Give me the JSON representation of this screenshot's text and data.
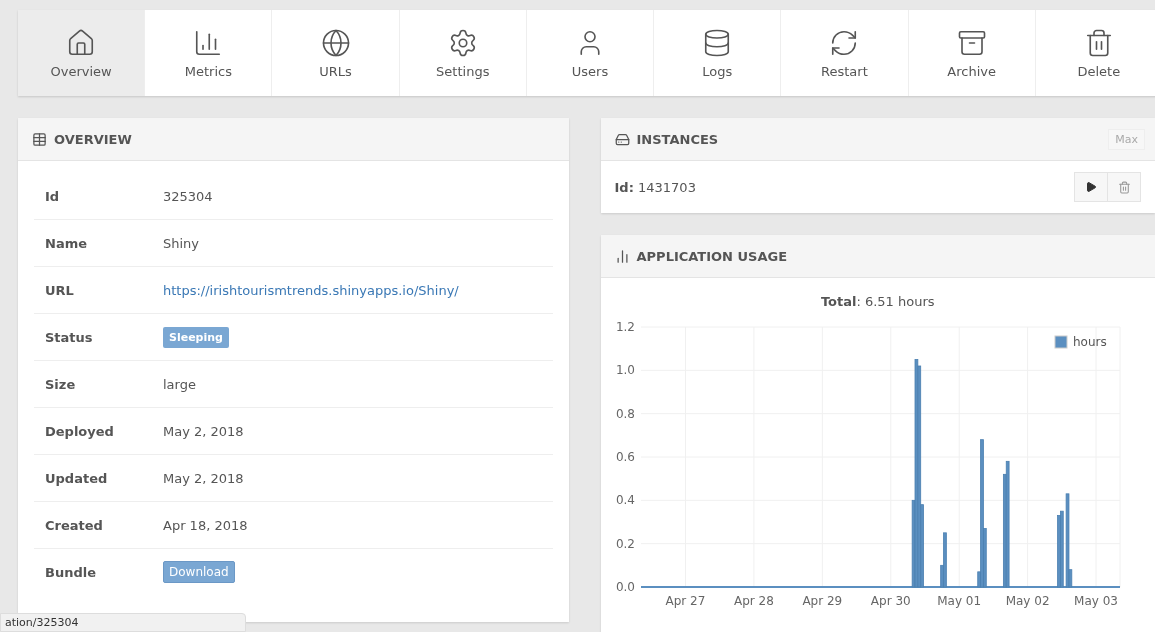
{
  "toolbar": [
    {
      "label": "Overview",
      "selected": true
    },
    {
      "label": "Metrics",
      "selected": false
    },
    {
      "label": "URLs",
      "selected": false
    },
    {
      "label": "Settings",
      "selected": false
    },
    {
      "label": "Users",
      "selected": false
    },
    {
      "label": "Logs",
      "selected": false
    },
    {
      "label": "Restart",
      "selected": false
    },
    {
      "label": "Archive",
      "selected": false
    },
    {
      "label": "Delete",
      "selected": false
    }
  ],
  "overview": {
    "title": "OVERVIEW",
    "rows": [
      {
        "label": "Id",
        "value": "325304",
        "kind": "text"
      },
      {
        "label": "Name",
        "value": "Shiny",
        "kind": "text"
      },
      {
        "label": "URL",
        "value": "https://irishtourismtrends.shinyapps.io/Shiny/",
        "kind": "link"
      },
      {
        "label": "Status",
        "value": "Sleeping",
        "kind": "badge"
      },
      {
        "label": "Size",
        "value": "large",
        "kind": "text"
      },
      {
        "label": "Deployed",
        "value": "May 2, 2018",
        "kind": "text"
      },
      {
        "label": "Updated",
        "value": "May 2, 2018",
        "kind": "text"
      },
      {
        "label": "Created",
        "value": "Apr 18, 2018",
        "kind": "text"
      },
      {
        "label": "Bundle",
        "value": "Download",
        "kind": "button"
      }
    ]
  },
  "instances": {
    "title": "INSTANCES",
    "max_button": "Max",
    "items": [
      {
        "id_label": "Id:",
        "id": "1431703"
      }
    ]
  },
  "usage": {
    "title": "APPLICATION USAGE",
    "total": "**Total**: 6.51 hours",
    "chart_data": {
      "type": "bar",
      "x": [
        "2018-04-30T08:00",
        "2018-04-30T09:00",
        "2018-04-30T10:00",
        "2018-04-30T11:00",
        "2018-04-30T18:00",
        "2018-04-30T19:00",
        "2018-05-01T07:00",
        "2018-05-01T08:00",
        "2018-05-01T09:00",
        "2018-05-01T16:00",
        "2018-05-01T17:00",
        "2018-05-02T11:00",
        "2018-05-02T12:00",
        "2018-05-02T14:00",
        "2018-05-02T15:00"
      ],
      "series": [
        {
          "name": "hours",
          "color": "#5b8fc0",
          "values": [
            0.4,
            1.05,
            1.02,
            0.38,
            0.1,
            0.25,
            0.07,
            0.68,
            0.27,
            0.52,
            0.58,
            0.33,
            0.35,
            0.43,
            0.08
          ]
        }
      ],
      "xlim": [
        "2018-04-26T08:24",
        "2018-05-03T08:24"
      ],
      "ylim": [
        0,
        1.2
      ],
      "grid": true,
      "xticks": [
        {
          "value": "2018-04-27",
          "label": "Apr 27"
        },
        {
          "value": "2018-04-28",
          "label": "Apr 28"
        },
        {
          "value": "2018-04-29",
          "label": "Apr 29"
        },
        {
          "value": "2018-04-30",
          "label": "Apr 30"
        },
        {
          "value": "2018-05-01",
          "label": "May 01"
        },
        {
          "value": "2018-05-02",
          "label": "May 02"
        },
        {
          "value": "2018-05-03",
          "label": "May 03"
        }
      ],
      "yticks": [
        {
          "value": 0,
          "label": "0.0"
        },
        {
          "value": 0.2,
          "label": "0.2"
        },
        {
          "value": 0.4,
          "label": "0.4"
        },
        {
          "value": 0.6,
          "label": "0.6"
        },
        {
          "value": 0.8,
          "label": "0.8"
        },
        {
          "value": 1,
          "label": "1.0"
        },
        {
          "value": 1.2,
          "label": "1.2"
        }
      ]
    }
  },
  "status_bar": "ation/325304"
}
